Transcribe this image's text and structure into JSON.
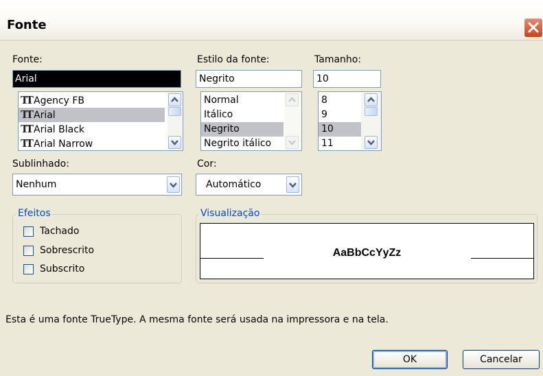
{
  "window": {
    "title": "Fonte"
  },
  "font": {
    "label": "Fonte:",
    "value": "Arial",
    "items": [
      "Agency FB",
      "Arial",
      "Arial Black",
      "Arial Narrow"
    ],
    "selected": "Arial"
  },
  "style": {
    "label": "Estilo da fonte:",
    "value": "Negrito",
    "items": [
      "Normal",
      "Itálico",
      "Negrito",
      "Negrito itálico"
    ],
    "selected": "Negrito"
  },
  "size": {
    "label": "Tamanho:",
    "value": "10",
    "items": [
      "8",
      "9",
      "10",
      "11"
    ],
    "selected": "10"
  },
  "underline": {
    "label": "Sublinhado:",
    "value": "Nenhum"
  },
  "color": {
    "label": "Cor:",
    "value": "Automático"
  },
  "effects": {
    "label": "Efeitos",
    "strikethrough": "Tachado",
    "superscript": "Sobrescrito",
    "subscript": "Subscrito"
  },
  "preview": {
    "label": "Visualização",
    "sample": "AaBbCcYyZz"
  },
  "info_text": "Esta é uma fonte TrueType. A mesma fonte será usada na impressora e na tela.",
  "buttons": {
    "ok": "OK",
    "cancel": "Cancelar"
  },
  "icons": {
    "close": "close-icon",
    "truetype": "truetype-icon",
    "scroll_up": "chevron-up-icon",
    "scroll_down": "chevron-down-icon",
    "dropdown": "chevron-down-icon"
  },
  "colors": {
    "title_bar": "#fbfaf6",
    "dialog_bg": "#ece9d8",
    "close_button": "#d9542c",
    "group_label": "#0046d5",
    "selection": "#c1c1c8"
  }
}
